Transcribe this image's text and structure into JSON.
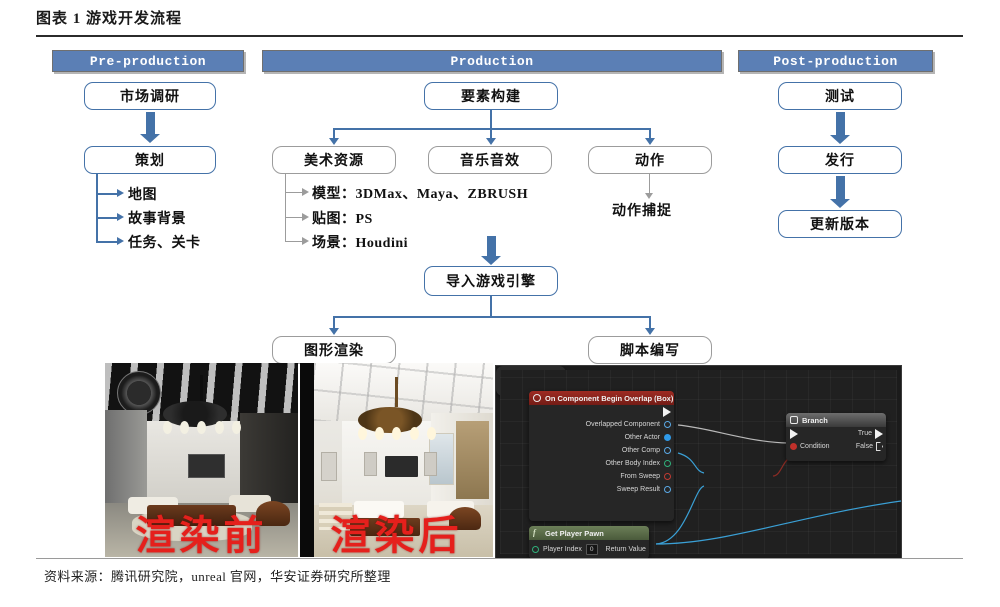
{
  "figure": {
    "title": "图表 1 游戏开发流程",
    "source": "资料来源：腾讯研究院，unreal 官网，华安证券研究所整理"
  },
  "colors": {
    "header_blue": "#5b7fb5",
    "box_border_blue": "#4472a8",
    "box_border_gray": "#9c9c9c",
    "arrow_blue": "#4472a8",
    "watermark_red": "#e5201c",
    "blueprint_bg": "#1b1b1b"
  },
  "phases": {
    "pre": "Pre-production",
    "production": "Production",
    "post": "Post-production"
  },
  "pre_production": {
    "market_research": "市场调研",
    "planning": "策划",
    "planning_items": [
      "地图",
      "故事背景",
      "任务、关卡"
    ]
  },
  "production": {
    "elements": "要素构建",
    "art": "美术资源",
    "audio": "音乐音效",
    "motion": "动作",
    "art_items": [
      "模型：3DMax、Maya、ZBRUSH",
      "贴图：PS",
      "场景：Houdini"
    ],
    "motion_item": "动作捕捉",
    "import_engine": "导入游戏引擎",
    "graphics_render": "图形渲染",
    "script_writing": "脚本编写"
  },
  "post_production": {
    "test": "测试",
    "publish": "发行",
    "update": "更新版本"
  },
  "renders": {
    "before_label": "渲染前",
    "after_label": "渲染后"
  },
  "blueprint": {
    "overlap_node": {
      "title": "On Component Begin Overlap (Box)",
      "pins": [
        "Overlapped Component",
        "Other Actor",
        "Other Comp",
        "Other Body Index",
        "From Sweep",
        "Sweep Result"
      ]
    },
    "get_player_pawn": {
      "title": "Get Player Pawn",
      "input_label": "Player Index",
      "input_value": "0",
      "output_label": "Return Value"
    },
    "branch_node": {
      "title": "Branch",
      "condition": "Condition",
      "true_label": "True",
      "false_label": "False"
    },
    "equals_node": {
      "symbol": "=="
    }
  }
}
